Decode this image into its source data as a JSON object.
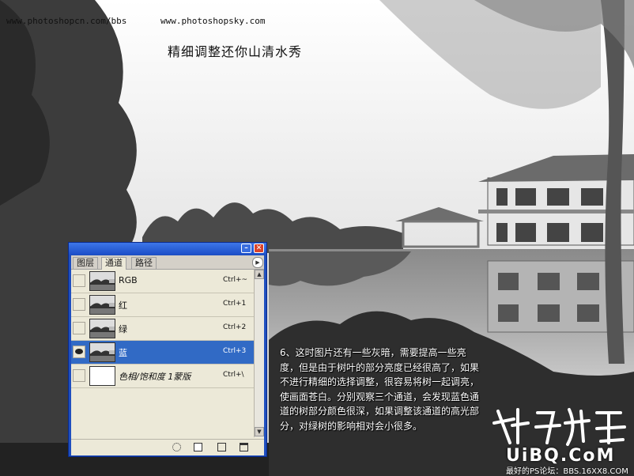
{
  "header": {
    "url_left": "www.photoshopcn.com/bbs",
    "url_right": "www.photoshopsky.com",
    "title": "精细调整还你山清水秀"
  },
  "panel": {
    "tabs": [
      {
        "label": "图层",
        "active": false
      },
      {
        "label": "通道",
        "active": true
      },
      {
        "label": "路径",
        "active": false
      }
    ],
    "channels": [
      {
        "name": "RGB",
        "shortcut": "Ctrl+~",
        "selected": false,
        "visible": false,
        "thumb": "photo"
      },
      {
        "name": "红",
        "shortcut": "Ctrl+1",
        "selected": false,
        "visible": false,
        "thumb": "photo"
      },
      {
        "name": "绿",
        "shortcut": "Ctrl+2",
        "selected": false,
        "visible": false,
        "thumb": "photo"
      },
      {
        "name": "蓝",
        "shortcut": "Ctrl+3",
        "selected": true,
        "visible": true,
        "thumb": "photo"
      },
      {
        "name": "色相/饱和度 1蒙版",
        "shortcut": "Ctrl+\\",
        "selected": false,
        "visible": false,
        "thumb": "white"
      }
    ],
    "footer_icons": [
      "load-selection-icon",
      "save-selection-icon",
      "new-channel-icon",
      "delete-channel-icon"
    ],
    "accent": "#316ac5"
  },
  "tutorial": {
    "text": "6、这时图片还有一些灰暗，需要提高一些亮度，但是由于树叶的部分亮度已经很高了，如果不进行精细的选择调整，很容易将树一起调亮，使画面苍白。分别观察三个通道，会发现蓝色通道的树部分颜色很深，如果调整该通道的高光部分，对绿树的影响相对会小很多。"
  },
  "branding": {
    "logo": "UiBQ.CoM",
    "sub": "最好的PS论坛：BBS.16XX8.COM"
  }
}
